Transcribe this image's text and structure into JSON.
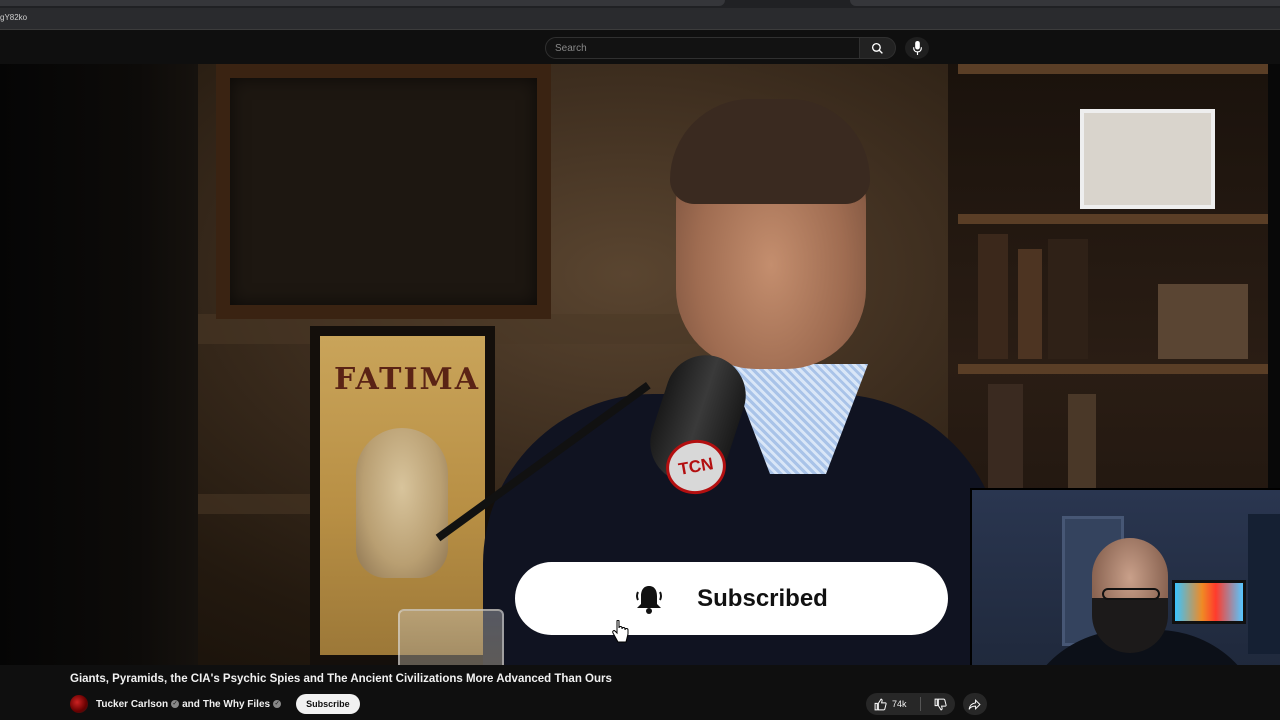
{
  "browser": {
    "url_fragment": "gY82ko"
  },
  "header": {
    "search_placeholder": "Search",
    "search_icon": "search-icon",
    "mic_icon": "microphone-icon"
  },
  "video": {
    "poster_text": "FATIMA",
    "mic_logo_text": "TCN"
  },
  "overlay": {
    "subscribed_label": "Subscribed",
    "bell_icon": "bell-icon"
  },
  "info": {
    "title": "Giants, Pyramids, the CIA's Psychic Spies and The Ancient Civilizations More Advanced Than Ours",
    "channel_primary": "Tucker Carlson",
    "channel_joiner": "and",
    "channel_secondary": "The Why Files",
    "subscribe_label": "Subscribe",
    "like_count": "74k"
  },
  "colors": {
    "background": "#0f0f0f",
    "mic_badge_red": "#b30f10"
  }
}
